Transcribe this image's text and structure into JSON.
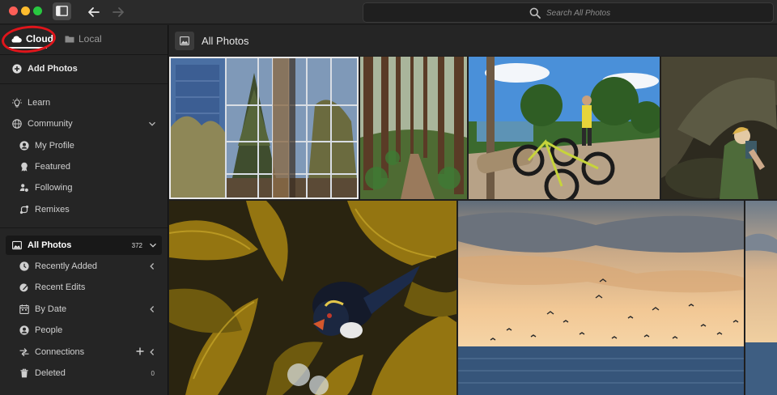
{
  "window": {
    "traffic_lights": {
      "close": "#fe5f57",
      "minimize": "#febc2e",
      "zoom": "#28c840"
    },
    "icons": [
      "sidebar-toggle-icon",
      "back-arrow-icon",
      "forward-arrow-icon"
    ]
  },
  "search": {
    "placeholder": "Search All Photos",
    "icon": "magnifier-icon"
  },
  "sources": {
    "cloud_label": "Cloud",
    "local_label": "Local",
    "active": "Cloud",
    "annotation_color": "#e0151b"
  },
  "sidebar": {
    "add_photos_label": "Add Photos",
    "learn_label": "Learn",
    "community": {
      "label": "Community",
      "items": [
        "My Profile",
        "Featured",
        "Following",
        "Remixes"
      ]
    },
    "library": {
      "all_photos_label": "All Photos",
      "all_photos_count": "372",
      "items": [
        {
          "label": "Recently Added",
          "has_chevron": true
        },
        {
          "label": "Recent Edits",
          "has_chevron": false
        },
        {
          "label": "By Date",
          "has_chevron": true
        },
        {
          "label": "People",
          "has_chevron": false
        },
        {
          "label": "Connections",
          "has_chevron": true,
          "has_plus": true
        },
        {
          "label": "Deleted",
          "count": "0"
        }
      ]
    }
  },
  "main": {
    "title": "All Photos",
    "photos": [
      {
        "subject": "glass building reflecting trees",
        "selected": true
      },
      {
        "subject": "redwood forest path"
      },
      {
        "subject": "mountain bikes by tree ferns"
      },
      {
        "subject": "person in rock cave"
      },
      {
        "subject": "penguin in kelp"
      },
      {
        "subject": "seabirds over sea at sunset"
      },
      {
        "subject": "sky over sea, partial"
      }
    ]
  },
  "theme": {
    "accent": "#e9e9e9",
    "background": "#1e1e1e",
    "sidebar": "#252525"
  }
}
